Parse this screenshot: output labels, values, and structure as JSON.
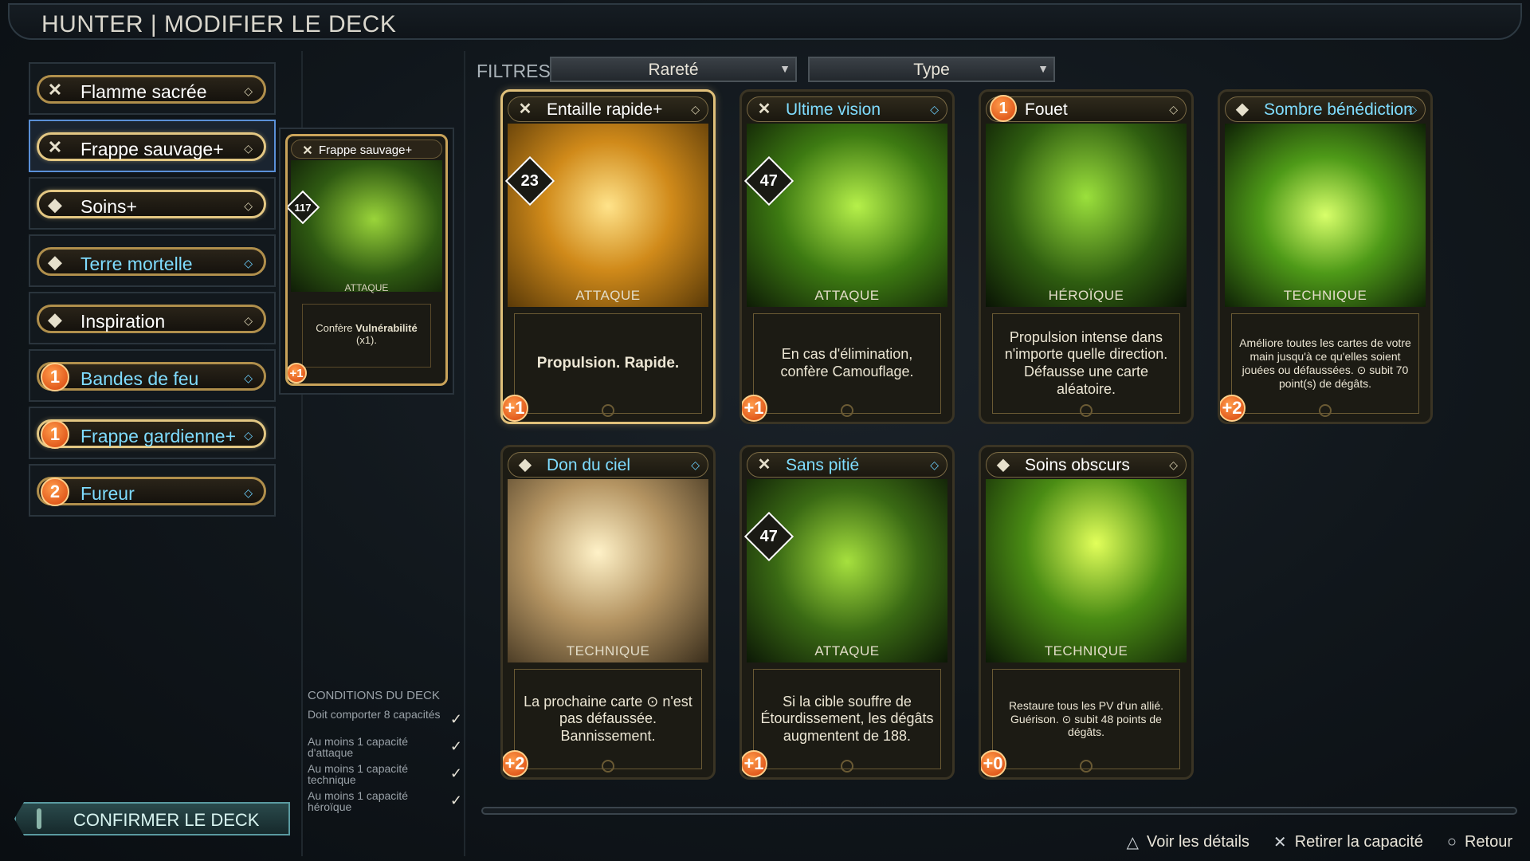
{
  "header": {
    "title": "HUNTER | MODIFIER LE DECK"
  },
  "deck": [
    {
      "name": "Flamme sacrée",
      "icon": "crossed-swords-icon",
      "symbol": "✕",
      "blue": false,
      "gold": false
    },
    {
      "name": "Frappe sauvage+",
      "icon": "crossed-swords-icon",
      "symbol": "✕",
      "blue": false,
      "gold": true
    },
    {
      "name": "Soins+",
      "icon": "shield-icon",
      "symbol": "◆",
      "blue": false,
      "gold": true
    },
    {
      "name": "Terre mortelle",
      "icon": "shield-icon",
      "symbol": "◆",
      "blue": true,
      "gold": false
    },
    {
      "name": "Inspiration",
      "icon": "shield-icon",
      "symbol": "◆",
      "blue": false,
      "gold": false
    },
    {
      "name": "Bandes de feu",
      "icon": "cost-icon",
      "cost": "1",
      "blue": true,
      "gold": false
    },
    {
      "name": "Frappe gardienne+",
      "icon": "cost-icon",
      "cost": "1",
      "blue": true,
      "gold": true
    },
    {
      "name": "Fureur",
      "icon": "cost-icon",
      "cost": "2",
      "blue": true,
      "gold": false
    }
  ],
  "preview": {
    "name": "Frappe sauvage+",
    "damage": "117",
    "type": "ATTAQUE",
    "text_prefix": "Confère ",
    "text_bold": "Vulnérabilité",
    "text_suffix": "(x1).",
    "cost": "+1"
  },
  "filters": {
    "label": "FILTRES",
    "rarity": "Rareté",
    "type": "Type"
  },
  "cards": [
    {
      "name": "Entaille rapide+",
      "blue": false,
      "gold": true,
      "damage": "23",
      "type": "ATTAQUE",
      "cost": "+1",
      "text": "Propulsion. Rapide.",
      "style": "bold",
      "icon": "crossed-swords-icon"
    },
    {
      "name": "Ultime vision",
      "blue": true,
      "gold": false,
      "damage": "47",
      "type": "ATTAQUE",
      "cost": "+1",
      "text": "En cas d'élimination, confère Camouflage.",
      "style": "",
      "icon": "crossed-swords-icon"
    },
    {
      "name": "Fouet",
      "blue": false,
      "gold": false,
      "damage": "",
      "type": "HÉROÏQUE",
      "cost": "",
      "headcost": "1",
      "text": "Propulsion intense dans n'importe quelle direction. Défausse une carte aléatoire.",
      "style": "",
      "icon": "cost-icon"
    },
    {
      "name": "Sombre bénédiction",
      "blue": true,
      "gold": false,
      "damage": "",
      "type": "TECHNIQUE",
      "cost": "+2",
      "text": "Améliore toutes les cartes de votre main jusqu'à ce qu'elles soient jouées ou défaussées. ⊙ subit 70 point(s) de dégâts.",
      "style": "small",
      "icon": "shield-icon"
    },
    {
      "name": "Don du ciel",
      "blue": true,
      "gold": false,
      "damage": "",
      "type": "TECHNIQUE",
      "cost": "+2",
      "text": "La prochaine carte ⊙ n'est pas défaussée. Bannissement.",
      "style": "",
      "icon": "shield-icon"
    },
    {
      "name": "Sans pitié",
      "blue": true,
      "gold": false,
      "damage": "47",
      "type": "ATTAQUE",
      "cost": "+1",
      "text": "Si la cible souffre de Étourdissement, les dégâts augmentent de 188.",
      "style": "",
      "icon": "crossed-swords-icon"
    },
    {
      "name": "Soins obscurs",
      "blue": false,
      "gold": false,
      "damage": "",
      "type": "TECHNIQUE",
      "cost": "+0",
      "text": "Restaure tous les PV d'un allié. Guérison. ⊙ subit 48 points de dégâts.",
      "style": "small",
      "icon": "shield-icon"
    }
  ],
  "conditions": {
    "title": "CONDITIONS DU DECK",
    "items": [
      "Doit comporter 8 capacités",
      "Au moins 1 capacité d'attaque",
      "Au moins 1 capacité technique",
      "Au moins 1 capacité héroïque"
    ],
    "check": "✓"
  },
  "confirm": {
    "label": "CONFIRMER LE DECK"
  },
  "hints": [
    {
      "icon": "triangle-icon",
      "glyph": "△",
      "label": "Voir les détails"
    },
    {
      "icon": "cross-icon",
      "glyph": "✕",
      "label": "Retirer la capacité"
    },
    {
      "icon": "circle-icon",
      "glyph": "○",
      "label": "Retour"
    }
  ]
}
